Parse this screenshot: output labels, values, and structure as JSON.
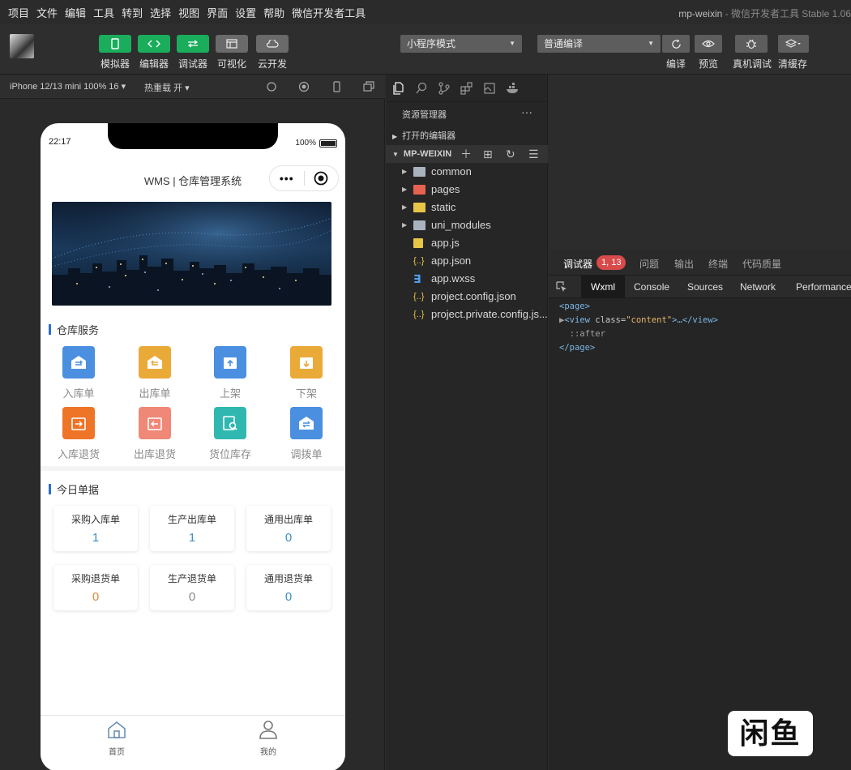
{
  "menu": {
    "items": [
      "项目",
      "文件",
      "编辑",
      "工具",
      "转到",
      "选择",
      "视图",
      "界面",
      "设置",
      "帮助",
      "微信开发者工具"
    ],
    "app_name": "mp-weixin",
    "app_subtitle": " - 微信开发者工具 Stable 1.06"
  },
  "toolbar": {
    "simulator": "模拟器",
    "editor": "编辑器",
    "debugger": "调试器",
    "visual": "可视化",
    "cloud": "云开发",
    "mode_select": "小程序模式",
    "compile_select": "普通编译",
    "compile": "编译",
    "preview": "预览",
    "real_debug": "真机调试",
    "clear_cache": "清缓存"
  },
  "simbar": {
    "device": "iPhone 12/13 mini 100% 16 ▾",
    "hot_reload": "热重载 开 ▾"
  },
  "phone": {
    "time": "22:17",
    "battery": "100%",
    "nav_title": "WMS | 仓库管理系统",
    "capsule_dots": "•••",
    "service_title": "仓库服务",
    "services": [
      {
        "label": "入库单",
        "color": "#4a8fe0"
      },
      {
        "label": "出库单",
        "color": "#eaaa38"
      },
      {
        "label": "上架",
        "color": "#4a8fe0"
      },
      {
        "label": "下架",
        "color": "#eaaa38"
      },
      {
        "label": "入库退货",
        "color": "#ee7428"
      },
      {
        "label": "出库退货",
        "color": "#f08878"
      },
      {
        "label": "货位库存",
        "color": "#30b8b0"
      },
      {
        "label": "调拨单",
        "color": "#4a8fe0"
      }
    ],
    "today_title": "今日单据",
    "cards": [
      {
        "title": "采购入库单",
        "value": "1",
        "color": "#3e8fc4"
      },
      {
        "title": "生产出库单",
        "value": "1",
        "color": "#3e8fc4"
      },
      {
        "title": "通用出库单",
        "value": "0",
        "color": "#3e8fc4"
      },
      {
        "title": "采购退货单",
        "value": "0",
        "color": "#e08a3a"
      },
      {
        "title": "生产退货单",
        "value": "0",
        "color": "#888888"
      },
      {
        "title": "通用退货单",
        "value": "0",
        "color": "#3e8fc4"
      }
    ],
    "tab_home": "首页",
    "tab_mine": "我的"
  },
  "explorer": {
    "title": "资源管理器",
    "more": "···",
    "open_editors": "打开的编辑器",
    "project": "MP-WEIXIN",
    "files": [
      {
        "name": "common",
        "type": "folder",
        "color": "#a8b3bf"
      },
      {
        "name": "pages",
        "type": "folder",
        "color": "#e8634f"
      },
      {
        "name": "static",
        "type": "folder",
        "color": "#e8c547"
      },
      {
        "name": "uni_modules",
        "type": "folder",
        "color": "#a8b3bf"
      },
      {
        "name": "app.js",
        "type": "js",
        "color": "#e8c547"
      },
      {
        "name": "app.json",
        "type": "json",
        "color": "#e8c547"
      },
      {
        "name": "app.wxss",
        "type": "wxss",
        "color": "#4aa0f0"
      },
      {
        "name": "project.config.json",
        "type": "json",
        "color": "#e8c547"
      },
      {
        "name": "project.private.config.js...",
        "type": "json",
        "color": "#e8c547"
      }
    ]
  },
  "debugger": {
    "tabs": [
      "调试器",
      "问题",
      "输出",
      "终端",
      "代码质量"
    ],
    "badge": "1, 13",
    "subtabs": [
      "Wxml",
      "Console",
      "Sources",
      "Network",
      "Performance"
    ],
    "code_page_open": "<page>",
    "code_view_open": "<view",
    "code_attr": " class=",
    "code_val": "\"content\"",
    "code_view_close": ">…</view>",
    "code_after": "::after",
    "code_page_close": "</page>"
  },
  "watermark": "闲鱼"
}
